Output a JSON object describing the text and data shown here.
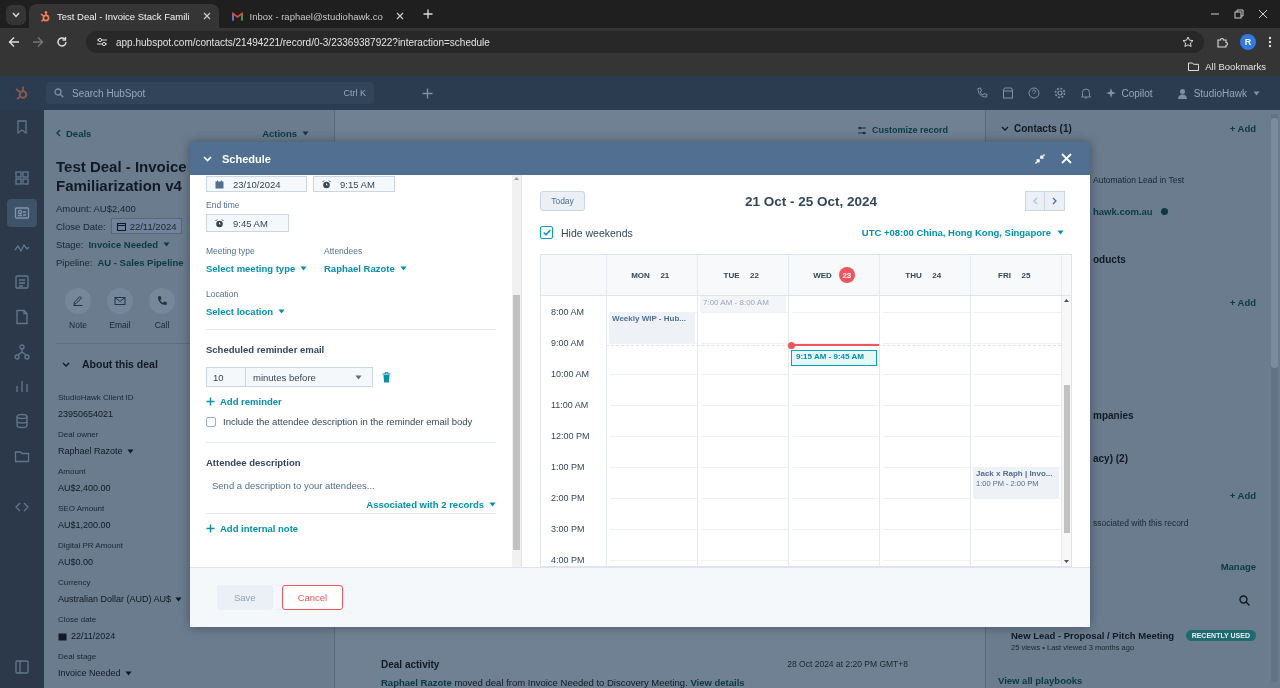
{
  "browser": {
    "tabs": [
      {
        "title": "Test Deal - Invoice Stack Famili",
        "kind": "hubspot",
        "selected": true
      },
      {
        "title": "Inbox - raphael@studiohawk.co",
        "kind": "mail",
        "selected": false
      }
    ],
    "url": "app.hubspot.com/contacts/21494221/record/0-3/23369387922?interaction=schedule",
    "profile": "R",
    "bookmarks": "All Bookmarks"
  },
  "topnav": {
    "search_placeholder": "Search HubSpot",
    "shortcut": "Ctrl K",
    "copilot": "Copilot",
    "account": "StudioHawk"
  },
  "sidebar": {
    "items": [
      {
        "kind": "bookmark",
        "selected": false
      },
      {
        "kind": "grid",
        "selected": false
      },
      {
        "kind": "card",
        "selected": true
      },
      {
        "kind": "wave",
        "selected": false
      },
      {
        "kind": "list",
        "selected": false
      },
      {
        "kind": "document",
        "selected": false
      },
      {
        "kind": "network",
        "selected": false
      },
      {
        "kind": "chart",
        "selected": false
      },
      {
        "kind": "database",
        "selected": false
      },
      {
        "kind": "folder",
        "selected": false
      },
      {
        "kind": "arrows",
        "selected": false
      },
      {
        "kind": "panel",
        "selected": false
      }
    ]
  },
  "record": {
    "back": "Deals",
    "actions": "Actions",
    "title_lines": [
      "Test Deal - Invoice",
      "Familiarization v4"
    ],
    "amount": "Amount: AU$2,400",
    "close_date_label": "Close Date:",
    "close_date": "22/11/2024",
    "stage_label": "Stage:",
    "stage": "Invoice Needed",
    "pipeline_label": "Pipeline:",
    "pipeline": "AU - Sales Pipeline",
    "quick_actions": [
      {
        "kind": "note",
        "label": "Note"
      },
      {
        "kind": "email",
        "label": "Email"
      },
      {
        "kind": "call",
        "label": "Call"
      }
    ],
    "section": "About this deal",
    "fields": [
      {
        "kind": "text",
        "label": "StudioHawk Client ID",
        "value": "23950654021"
      },
      {
        "kind": "select",
        "label": "Deal owner",
        "value": "Raphael Razote"
      },
      {
        "kind": "text",
        "label": "Amount",
        "value": "AU$2,400.00"
      },
      {
        "kind": "text",
        "label": "SEO Amount",
        "value": "AU$1,200.00"
      },
      {
        "kind": "text",
        "label": "Digital PR Amount",
        "value": "AU$0.00"
      },
      {
        "kind": "select",
        "label": "Currency",
        "value": "Australian Dollar (AUD) AU$"
      },
      {
        "kind": "date",
        "label": "Close date",
        "value": "22/11/2024"
      },
      {
        "kind": "select",
        "label": "Deal stage",
        "value": "Invoice Needed"
      }
    ]
  },
  "middle": {
    "customize": "Customize record",
    "activity_heading": "Deal activity",
    "activity_time": "28 Oct 2024 at 2:20 PM GMT+8",
    "activity_actor": "Raphael Razote",
    "activity_text": " moved deal from Invoice Needed to Discovery Meeting. ",
    "activity_link": "View details"
  },
  "right": {
    "rows": [
      {
        "kind": "heading",
        "text": "Contacts (1)",
        "action": "+ Add"
      },
      {
        "kind": "note",
        "text": "Automation Lead in Test"
      },
      {
        "kind": "email",
        "text": "hawk.com.au"
      },
      {
        "kind": "heading",
        "text": "oducts"
      },
      {
        "kind": "action",
        "action": "+ Add"
      },
      {
        "kind": "heading",
        "text": "mpanies"
      },
      {
        "kind": "heading",
        "text": "acy) (2)"
      },
      {
        "kind": "action",
        "action": "+ Add"
      },
      {
        "kind": "note",
        "text": "ssociated with this record"
      },
      {
        "kind": "action",
        "action": "Manage"
      },
      {
        "kind": "search"
      },
      {
        "kind": "playbook",
        "text": "New Lead - Proposal / Pitch Meeting",
        "badge": "RECENTLY USED",
        "meta": "25 views • Last viewed 3 months ago"
      },
      {
        "kind": "link",
        "text": "View all playbooks"
      }
    ]
  },
  "modal": {
    "title": "Schedule",
    "start_date": "23/10/2024",
    "start_time": "9:15 AM",
    "end_label": "End time",
    "end_time": "9:45 AM",
    "meeting_type_label": "Meeting type",
    "meeting_type": "Select meeting type",
    "attendees_label": "Attendees",
    "attendees": "Raphael Razote",
    "location_label": "Location",
    "location": "Select location",
    "reminder_heading": "Scheduled reminder email",
    "reminder_amount": "10",
    "reminder_unit": "minutes before",
    "add_reminder": "Add reminder",
    "include_description": {
      "label": "Include the attendee description in the reminder email body",
      "checked": false
    },
    "description_heading": "Attendee description",
    "description_placeholder": "Send a description to your attendees...",
    "associated": "Associated with 2 records",
    "add_note": "Add internal note",
    "save": {
      "label": "Save",
      "disabled": true
    },
    "cancel": "Cancel",
    "calendar": {
      "today": "Today",
      "range": "21 Oct - 25 Oct, 2024",
      "hide_weekends": {
        "label": "Hide weekends",
        "checked": true
      },
      "timezone": "UTC +08:00 China, Hong Kong, Singapore",
      "days": [
        {
          "name": "MON",
          "date": "21",
          "today": false,
          "now_line": false,
          "events": [
            {
              "kind": "busy",
              "title": "Weekly WIP - Hub..."
            }
          ]
        },
        {
          "name": "TUE",
          "date": "22",
          "today": false,
          "now_line": false,
          "events": [
            {
              "kind": "past",
              "time": "7:00 AM - 8:00 AM"
            }
          ]
        },
        {
          "name": "WED",
          "date": "23",
          "today": true,
          "now_line": true,
          "events": [
            {
              "kind": "new",
              "time": "9:15 AM - 9:45 AM"
            }
          ]
        },
        {
          "name": "THU",
          "date": "24",
          "today": false,
          "now_line": false
        },
        {
          "name": "FRI",
          "date": "25",
          "today": false,
          "now_line": false,
          "events": [
            {
              "kind": "busy",
              "title": "Jack x Raph | Invo...",
              "time": "1:00 PM - 2:00 PM"
            }
          ]
        }
      ],
      "hours": [
        "8:00 AM",
        "9:00 AM",
        "10:00 AM",
        "11:00 AM",
        "12:00 PM",
        "1:00 PM",
        "2:00 PM",
        "3:00 PM",
        "4:00 PM"
      ]
    }
  }
}
